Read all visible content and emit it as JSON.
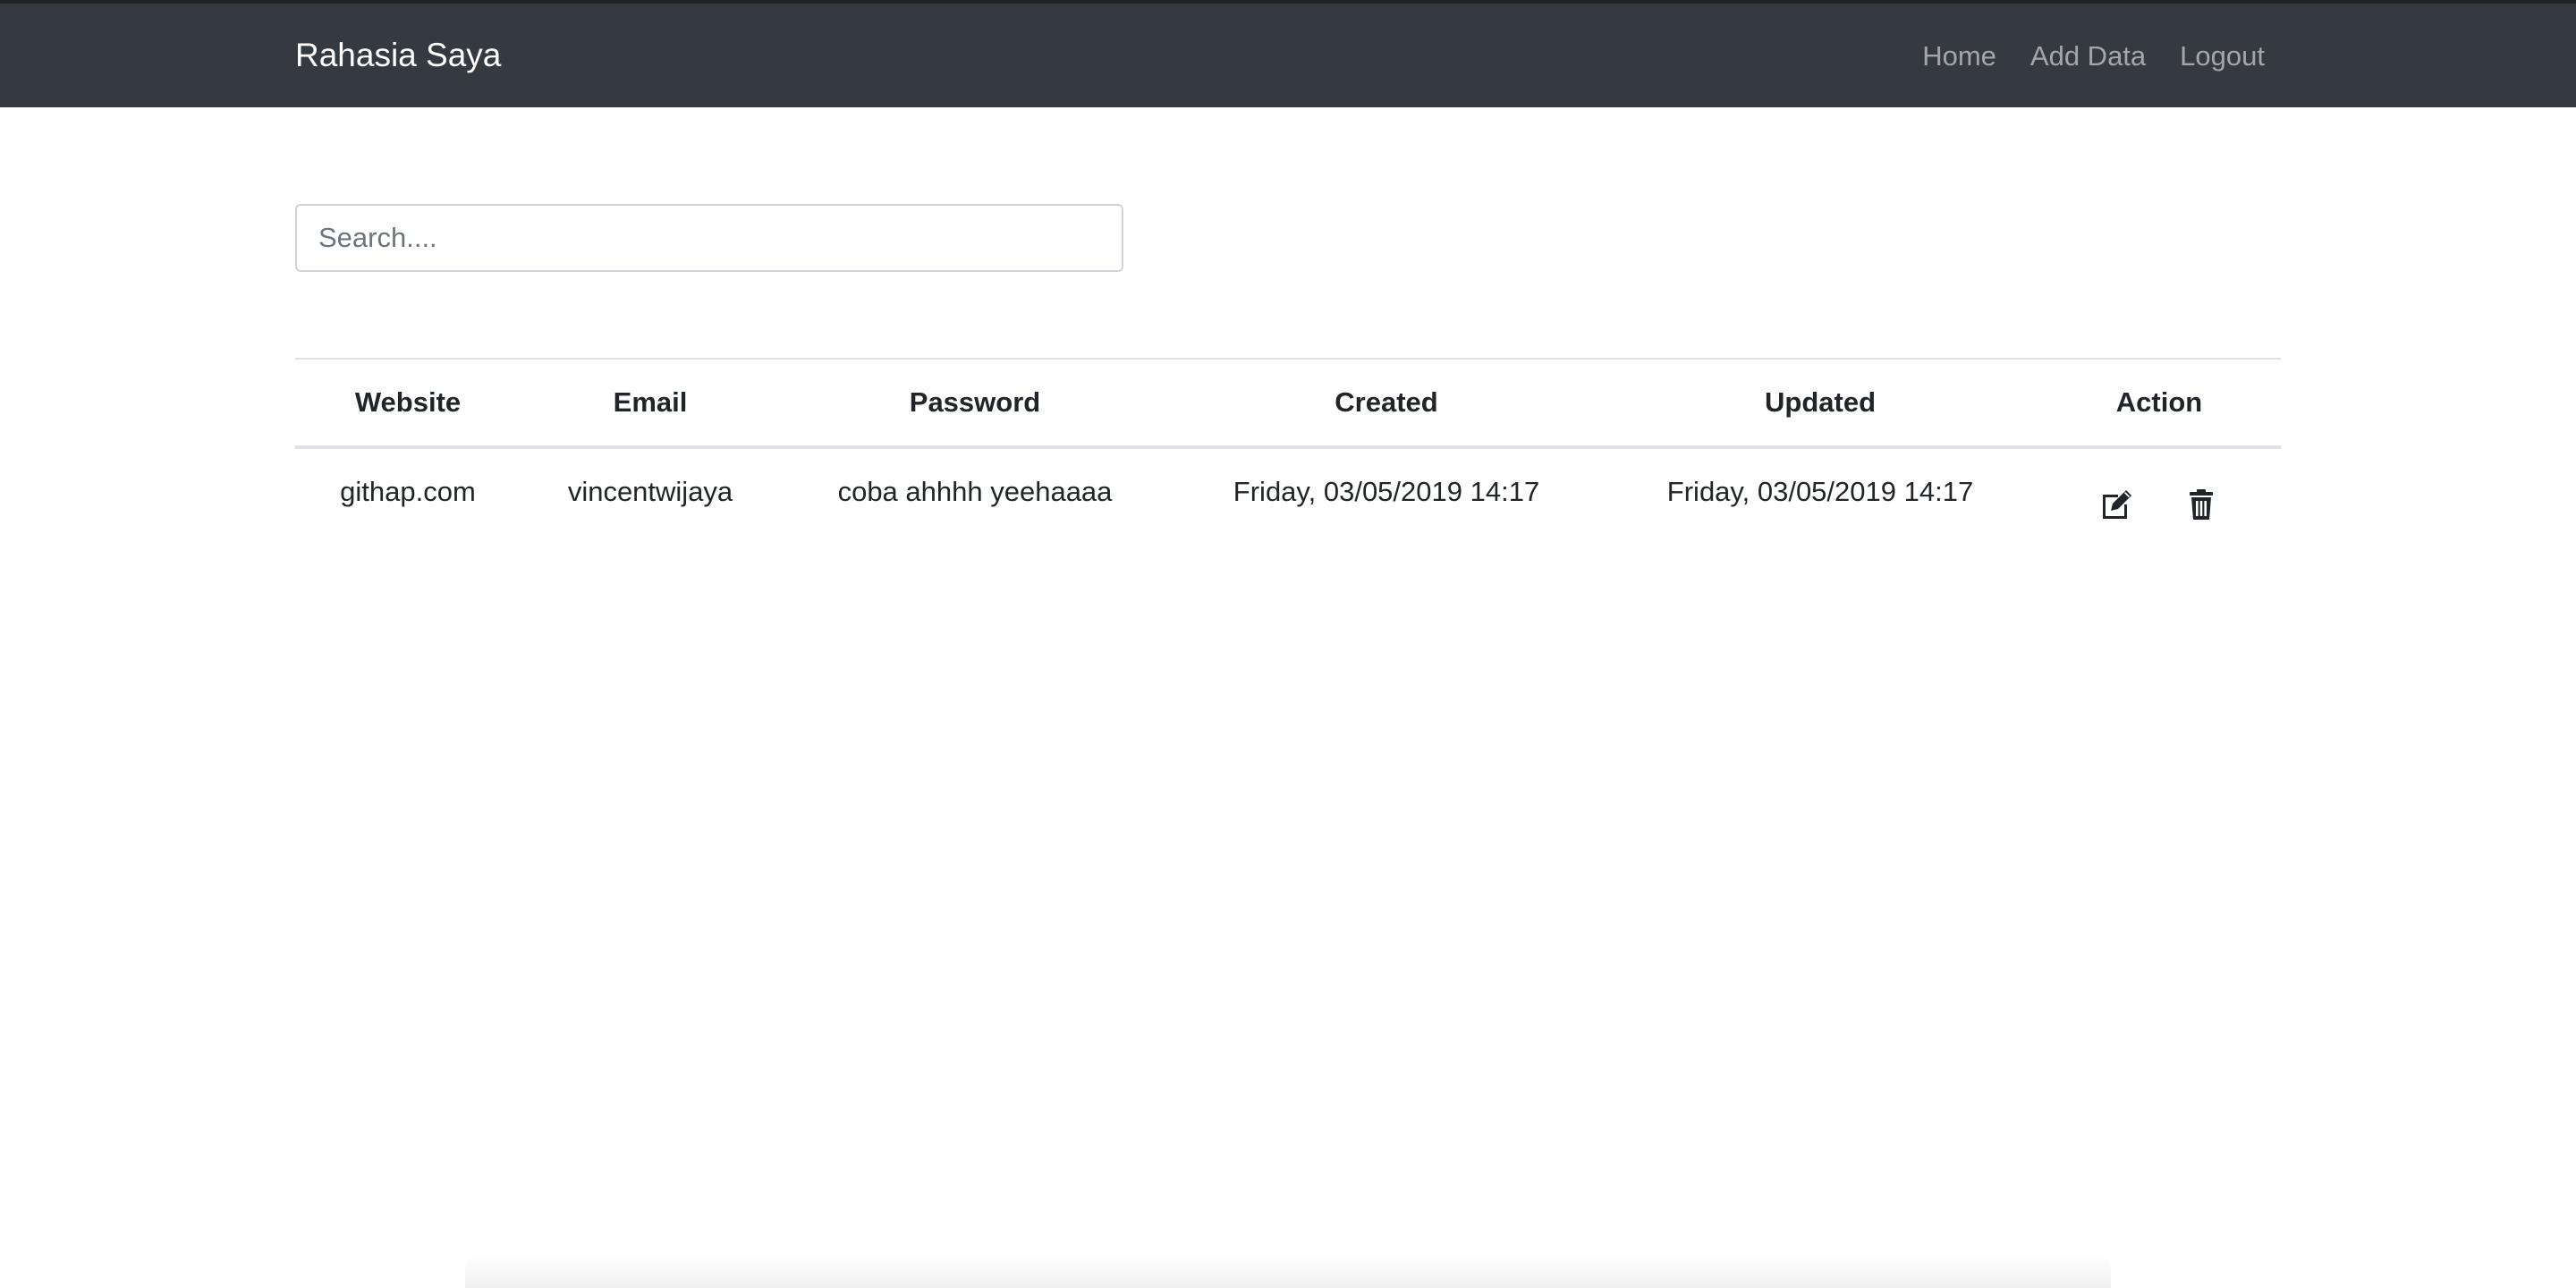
{
  "navbar": {
    "brand": "Rahasia Saya",
    "links": [
      {
        "label": "Home"
      },
      {
        "label": "Add Data"
      },
      {
        "label": "Logout"
      }
    ]
  },
  "search": {
    "placeholder": "Search....",
    "value": ""
  },
  "table": {
    "columns": [
      "Website",
      "Email",
      "Password",
      "Created",
      "Updated",
      "Action"
    ],
    "rows": [
      {
        "website": "githap.com",
        "email": "vincentwijaya",
        "password": "coba ahhhh yeehaaaa",
        "created": "Friday, 03/05/2019 14:17",
        "updated": "Friday, 03/05/2019 14:17",
        "actions": [
          "edit-icon",
          "trash-icon"
        ]
      }
    ]
  },
  "colors": {
    "navbar_bg": "#343a40",
    "brand_text": "#ffffff",
    "nav_link_text": "rgba(255,255,255,0.55)",
    "table_border": "#dee2e6"
  }
}
